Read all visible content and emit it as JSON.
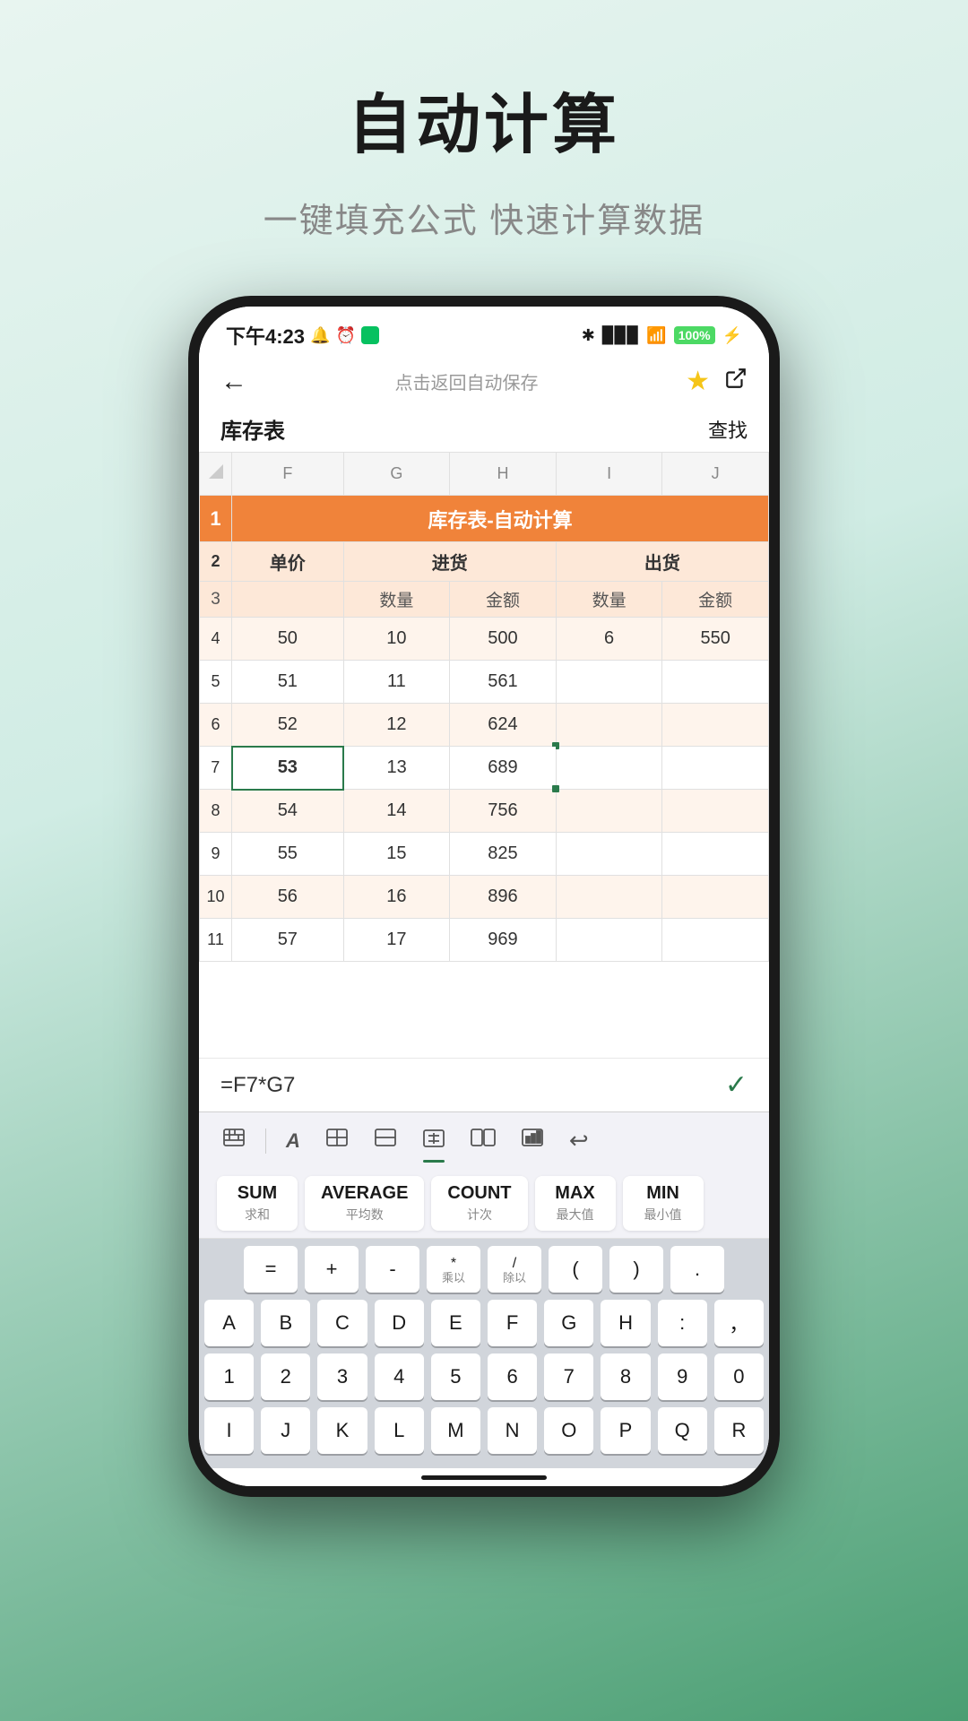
{
  "page": {
    "title": "自动计算",
    "subtitle": "一键填充公式 快速计算数据"
  },
  "status_bar": {
    "time": "下午4:23",
    "icons_left": [
      "alarm",
      "clock",
      "wechat"
    ],
    "battery": "100"
  },
  "toolbar": {
    "back_label": "←",
    "center_text": "点击返回自动保存",
    "star": "★",
    "share": "↗"
  },
  "sheet": {
    "title": "库存表",
    "find": "查找",
    "spreadsheet_title": "库存表-自动计算"
  },
  "columns": [
    "F",
    "G",
    "H",
    "I",
    "J"
  ],
  "rows": [
    {
      "id": "1",
      "type": "title",
      "cells": [
        "",
        "",
        "库存表-自动计算",
        "",
        ""
      ]
    },
    {
      "id": "2",
      "type": "header",
      "cells": [
        "单价",
        "进货",
        "",
        "出货",
        ""
      ]
    },
    {
      "id": "3",
      "type": "subheader",
      "cells": [
        "",
        "数量",
        "金额",
        "数量",
        "金额"
      ]
    },
    {
      "id": "4",
      "type": "data",
      "cells": [
        "50",
        "10",
        "500",
        "6",
        "550"
      ],
      "shaded": true
    },
    {
      "id": "5",
      "type": "data",
      "cells": [
        "51",
        "11",
        "561",
        "",
        ""
      ]
    },
    {
      "id": "6",
      "type": "data",
      "cells": [
        "52",
        "12",
        "624",
        "",
        ""
      ],
      "shaded": true
    },
    {
      "id": "7",
      "type": "data",
      "cells": [
        "53",
        "13",
        "689",
        "",
        ""
      ],
      "selected_col": 0
    },
    {
      "id": "8",
      "type": "data",
      "cells": [
        "54",
        "14",
        "756",
        "",
        ""
      ],
      "shaded": true
    },
    {
      "id": "9",
      "type": "data",
      "cells": [
        "55",
        "15",
        "825",
        "",
        ""
      ]
    },
    {
      "id": "10",
      "type": "data",
      "cells": [
        "56",
        "16",
        "896",
        "",
        ""
      ],
      "shaded": true
    },
    {
      "id": "11",
      "type": "data",
      "cells": [
        "57",
        "17",
        "969",
        "",
        ""
      ]
    }
  ],
  "formula": "=F7*G7",
  "check_icon": "✓",
  "keyboard_toolbar": {
    "icons": [
      "⊞",
      "A",
      "⊟",
      "⊡",
      "⊠",
      "⊞⊞",
      "⊞⊡",
      "↩"
    ]
  },
  "functions": [
    {
      "name": "SUM",
      "desc": "求和"
    },
    {
      "name": "AVERAGE",
      "desc": "平均数"
    },
    {
      "name": "COUNT",
      "desc": "计次"
    },
    {
      "name": "MAX",
      "desc": "最大值"
    },
    {
      "name": "MIN",
      "desc": "最小值"
    }
  ],
  "operator_keys": [
    "=",
    "+",
    "-",
    "*\n乘以",
    "/\n除以",
    "(",
    ")",
    "."
  ],
  "letter_keys_row1": [
    "A",
    "B",
    "C",
    "D",
    "E",
    "F",
    "G",
    "H",
    ":",
    "，"
  ],
  "letter_keys_row2": [
    "1",
    "2",
    "3",
    "4",
    "5",
    "6",
    "7",
    "8",
    "9",
    "0"
  ],
  "letter_keys_row3": [
    "I",
    "J",
    "K",
    "L",
    "M",
    "N",
    "O",
    "P",
    "Q",
    "R"
  ]
}
